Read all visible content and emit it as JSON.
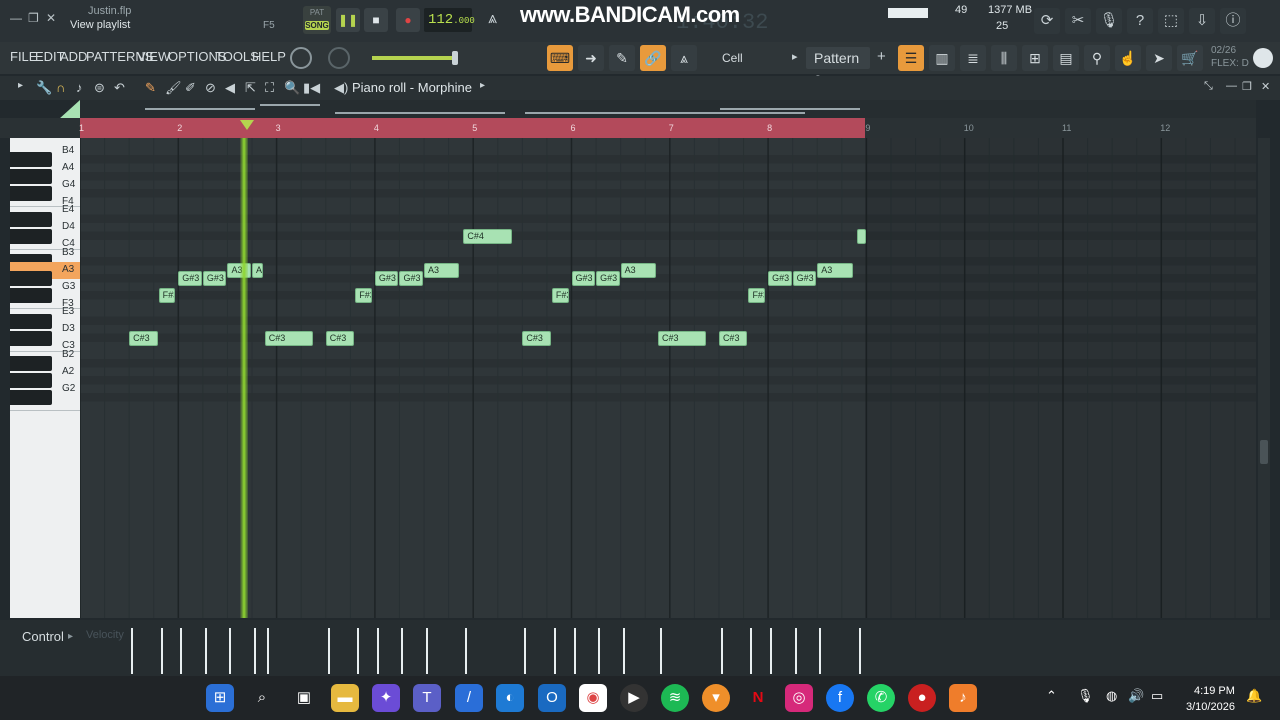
{
  "window": {
    "file_name": "Justin.flp",
    "subtitle": "View playlist",
    "hint_key": "F5"
  },
  "transport": {
    "pat_label": "PAT",
    "song_label": "SONG",
    "tempo_main": "112",
    "tempo_frac": ".000",
    "time_display": "1:40:32",
    "recording_watermark": "www.BANDICAM.com"
  },
  "meters": {
    "cpu": "49",
    "memory": "1377 MB",
    "polyphony": "25"
  },
  "menu": {
    "items": [
      "FILE",
      "EDIT",
      "ADD",
      "PATTERNS",
      "VIEW",
      "OPTIONS",
      "TOOLS",
      "HELP"
    ],
    "cell_label": "Cell",
    "pattern_label": "Pattern 9",
    "plus": "+",
    "flex_date": "02/26",
    "flex_label": "FLEX: D"
  },
  "piano_roll": {
    "title": "Piano roll - Morphine",
    "bar_numbers": [
      "1",
      "2",
      "3",
      "4",
      "5",
      "6",
      "7",
      "8",
      "9",
      "10",
      "11",
      "12"
    ],
    "key_labels": [
      "B4",
      "A4",
      "G4",
      "F4",
      "E4",
      "D4",
      "C4",
      "B3",
      "A3",
      "G3",
      "F3",
      "E3",
      "D3",
      "C3",
      "B2",
      "A2",
      "G2"
    ],
    "highlighted_key": "A3",
    "notes": [
      {
        "label": "C#4",
        "bar": 4.9,
        "len": 0.5,
        "row": "C#4"
      },
      {
        "label": "",
        "bar": 8.9,
        "len": 0.1,
        "row": "C#4"
      },
      {
        "label": "A3",
        "bar": 2.5,
        "len": 0.25,
        "row": "A3"
      },
      {
        "label": "A3",
        "bar": 2.75,
        "len": 0.12,
        "row": "A3"
      },
      {
        "label": "G#3",
        "bar": 2.0,
        "len": 0.25,
        "row": "G#3"
      },
      {
        "label": "G#3",
        "bar": 2.25,
        "len": 0.25,
        "row": "G#3"
      },
      {
        "label": "F#3",
        "bar": 1.8,
        "len": 0.18,
        "row": "F#3"
      },
      {
        "label": "C#3",
        "bar": 1.5,
        "len": 0.3,
        "row": "C#3"
      },
      {
        "label": "A3",
        "bar": 4.5,
        "len": 0.37,
        "row": "A3"
      },
      {
        "label": "G#3",
        "bar": 4.0,
        "len": 0.25,
        "row": "G#3"
      },
      {
        "label": "G#3",
        "bar": 4.25,
        "len": 0.25,
        "row": "G#3"
      },
      {
        "label": "F#3",
        "bar": 3.8,
        "len": 0.18,
        "row": "F#3"
      },
      {
        "label": "C#3",
        "bar": 2.88,
        "len": 0.5,
        "row": "C#3"
      },
      {
        "label": "C#3",
        "bar": 3.5,
        "len": 0.3,
        "row": "C#3"
      },
      {
        "label": "A3",
        "bar": 6.5,
        "len": 0.37,
        "row": "A3"
      },
      {
        "label": "G#3",
        "bar": 6.0,
        "len": 0.25,
        "row": "G#3"
      },
      {
        "label": "G#3",
        "bar": 6.25,
        "len": 0.25,
        "row": "G#3"
      },
      {
        "label": "F#3",
        "bar": 5.8,
        "len": 0.18,
        "row": "F#3"
      },
      {
        "label": "C#3",
        "bar": 5.5,
        "len": 0.3,
        "row": "C#3"
      },
      {
        "label": "A3",
        "bar": 8.5,
        "len": 0.37,
        "row": "A3"
      },
      {
        "label": "G#3",
        "bar": 8.0,
        "len": 0.25,
        "row": "G#3"
      },
      {
        "label": "G#3",
        "bar": 8.25,
        "len": 0.25,
        "row": "G#3"
      },
      {
        "label": "F#3",
        "bar": 7.8,
        "len": 0.18,
        "row": "F#3"
      },
      {
        "label": "C#3",
        "bar": 6.88,
        "len": 0.5,
        "row": "C#3"
      },
      {
        "label": "C#3",
        "bar": 7.5,
        "len": 0.3,
        "row": "C#3"
      }
    ]
  },
  "control": {
    "label": "Control",
    "sub_label": "Velocity"
  },
  "taskbar": {
    "time": "4:19 PM",
    "date": "3/10/2026"
  }
}
